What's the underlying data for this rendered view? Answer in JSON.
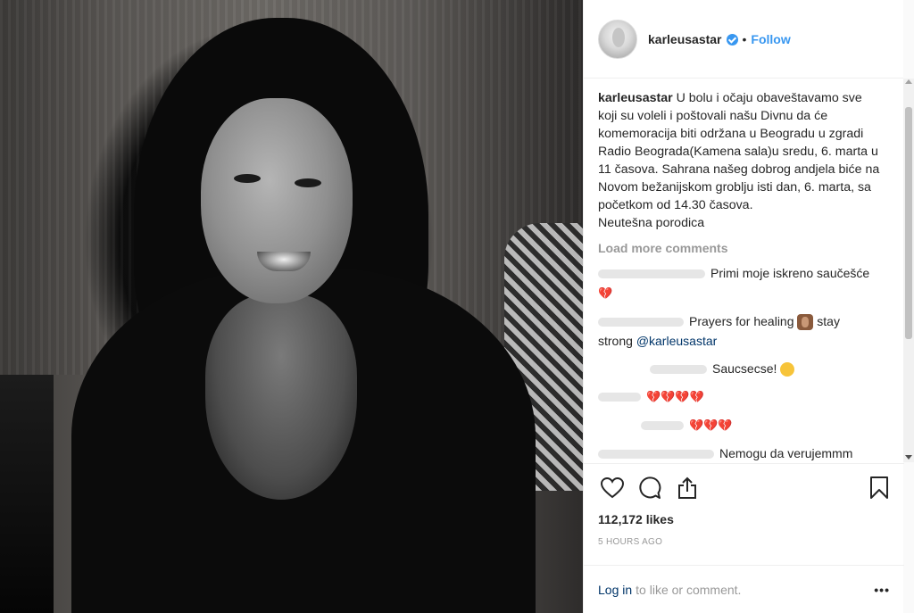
{
  "post": {
    "username": "karleusastar",
    "follow_label": "Follow",
    "separator": "•",
    "caption": "U bolu i očaju obaveštavamo sve koji su voleli i poštovali našu Divnu da će komemoracija biti održana u Beogradu u zgradi Radio Beograda(Kamena sala)u sredu, 6. marta u 11 časova. Sahrana našeg dobrog andjela biće na Novom bežanijskom groblju isti dan, 6. marta, sa početkom od 14.30 časova.\nNeutešna porodica",
    "load_more": "Load more comments"
  },
  "comments": [
    {
      "text": "Primi moje iskreno saučešće",
      "suffix": "💔"
    },
    {
      "text": "Prayers for healing",
      "suffix2": "stay strong",
      "mention": "@karleusastar"
    },
    {
      "text": "Saucsecse!"
    },
    {
      "hearts": "💔💔💔💔"
    },
    {
      "hearts": "💔💔💔"
    },
    {
      "text": "Nemogu da verujemmm"
    }
  ],
  "stats": {
    "likes": "112,172 likes",
    "time": "5 HOURS AGO"
  },
  "login": {
    "link": "Log in",
    "rest": "to like or comment.",
    "more": "•••"
  },
  "colors": {
    "accent": "#3897f0",
    "link": "#003569",
    "muted": "#999999",
    "heart": "#c4002a"
  },
  "icons": [
    "verified-badge-icon",
    "heart-icon",
    "comment-icon",
    "share-icon",
    "bookmark-icon",
    "more-options-icon"
  ]
}
